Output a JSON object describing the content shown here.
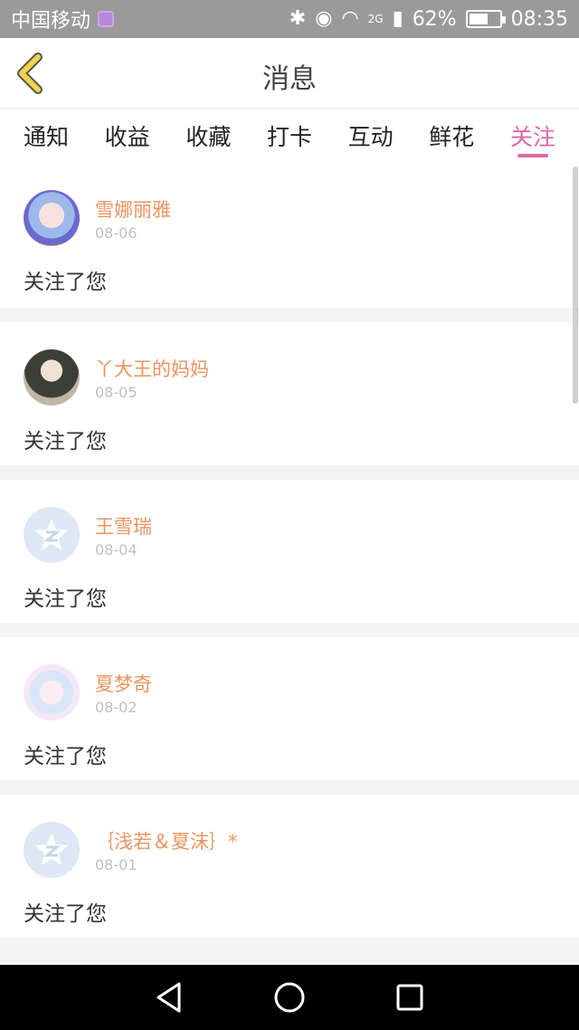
{
  "status": {
    "carrier": "中国移动",
    "network": "2G",
    "battery": "62%",
    "battery_level": 0.62,
    "time": "08:35"
  },
  "header": {
    "title": "消息"
  },
  "tabs": [
    {
      "label": "通知",
      "active": false
    },
    {
      "label": "收益",
      "active": false
    },
    {
      "label": "收藏",
      "active": false
    },
    {
      "label": "打卡",
      "active": false
    },
    {
      "label": "互动",
      "active": false
    },
    {
      "label": "鲜花",
      "active": false
    },
    {
      "label": "关注",
      "active": true
    }
  ],
  "items": [
    {
      "name": "雪娜丽雅",
      "date": "08-06",
      "text": "关注了您",
      "avatar": "photo"
    },
    {
      "name": "丫大王的妈妈",
      "date": "08-05",
      "text": "关注了您",
      "avatar": "photo"
    },
    {
      "name": "王雪瑞",
      "date": "08-04",
      "text": "关注了您",
      "avatar": "default-qzone-icon"
    },
    {
      "name": "夏梦奇",
      "date": "08-02",
      "text": "关注了您",
      "avatar": "photo"
    },
    {
      "name": "｛浅若＆夏沫｝*",
      "date": "08-01",
      "text": "关注了您",
      "avatar": "default-qzone-icon"
    }
  ],
  "colors": {
    "accent": "#e0679f",
    "username": "#ea9460",
    "back_arrow": "#f2d34a"
  }
}
